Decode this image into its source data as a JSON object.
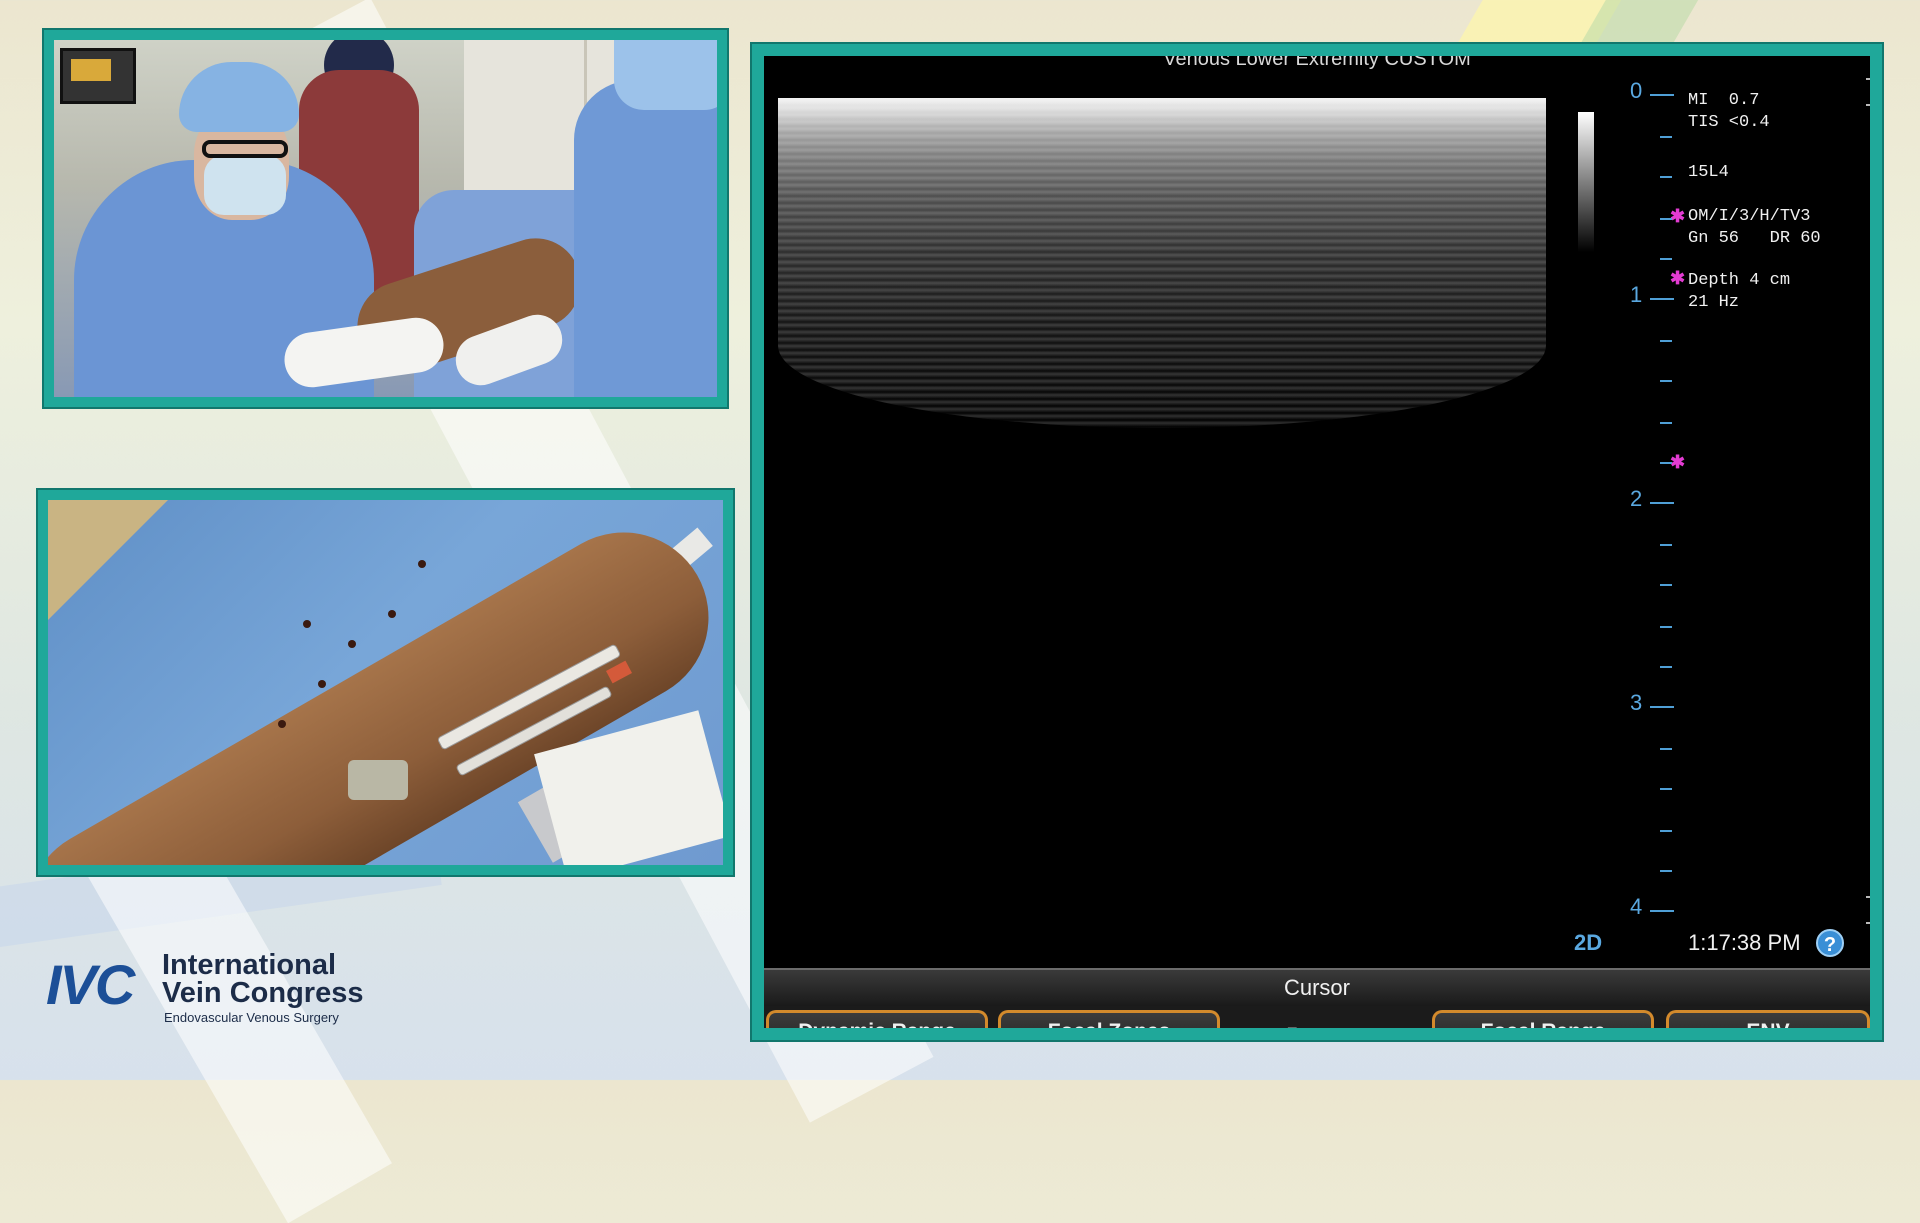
{
  "ultrasound": {
    "header": "Venous Lower Extremity CUSTOM",
    "params": {
      "mi": "MI  0.7",
      "tis": "TIS <0.4",
      "probe": "15L4",
      "mode_settings": "OM/I/3/H/TV3",
      "gain_dr": "Gn 56   DR 60",
      "depth": "Depth 4 cm",
      "frame_rate": "21 Hz"
    },
    "depth_labels": [
      "0",
      "1",
      "2",
      "3",
      "4"
    ],
    "mode": "2D",
    "time": "1:17:38 PM",
    "help_glyph": "?",
    "cursor_label": "Cursor",
    "softkeys": [
      "Dynamic Range",
      "Focal Zones",
      "Focal Range",
      "ENV"
    ],
    "softkey_arrows": "←  −  →"
  },
  "logo": {
    "mark": "IVC",
    "line1": "International",
    "line2": "Vein Congress",
    "line3": "Endovascular Venous Surgery"
  },
  "icons": {
    "help": "help-icon",
    "focal_marker": "focal-star-icon"
  },
  "colors": {
    "frame": "#1fa89a",
    "depth_scale": "#5aa8e0",
    "focal_marker": "#e33bd2",
    "softkey_border": "#d38a2c",
    "logo": "#1c4f97"
  }
}
